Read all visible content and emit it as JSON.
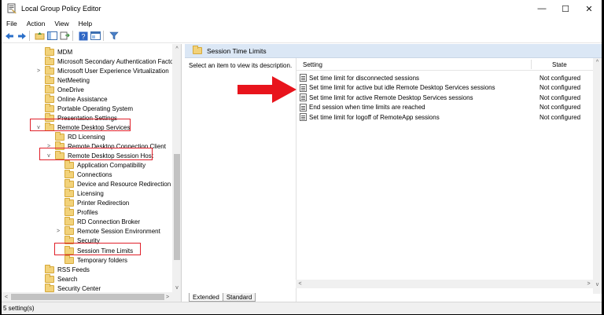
{
  "window": {
    "title": "Local Group Policy Editor",
    "minimize_glyph": "—",
    "maximize_glyph": "☐",
    "close_glyph": "✕"
  },
  "menu": [
    "File",
    "Action",
    "View",
    "Help"
  ],
  "toolbar": {
    "icons": [
      "back-arrow-icon",
      "forward-arrow-icon",
      "folder-up-icon",
      "show-hide-tree-icon",
      "export-list-icon",
      "help-icon",
      "properties-icon",
      "filter-icon"
    ]
  },
  "tree": {
    "items": [
      {
        "label": "MDM",
        "expander": ""
      },
      {
        "label": "Microsoft Secondary Authentication Facto",
        "expander": ""
      },
      {
        "label": "Microsoft User Experience Virtualization",
        "expander": ">"
      },
      {
        "label": "NetMeeting",
        "expander": ""
      },
      {
        "label": "OneDrive",
        "expander": ""
      },
      {
        "label": "Online Assistance",
        "expander": ""
      },
      {
        "label": "Portable Operating System",
        "expander": ""
      },
      {
        "label": "Presentation Settings",
        "expander": ""
      },
      {
        "label": "Remote Desktop Services",
        "expander": "v"
      },
      {
        "label": "RD Licensing",
        "expander": ""
      },
      {
        "label": "Remote Desktop Connection Client",
        "expander": ">"
      },
      {
        "label": "Remote Desktop Session Host",
        "expander": "v"
      },
      {
        "label": "Application Compatibility",
        "expander": ""
      },
      {
        "label": "Connections",
        "expander": ""
      },
      {
        "label": "Device and Resource Redirection",
        "expander": ""
      },
      {
        "label": "Licensing",
        "expander": ""
      },
      {
        "label": "Printer Redirection",
        "expander": ""
      },
      {
        "label": "Profiles",
        "expander": ""
      },
      {
        "label": "RD Connection Broker",
        "expander": ""
      },
      {
        "label": "Remote Session Environment",
        "expander": ">"
      },
      {
        "label": "Security",
        "expander": ""
      },
      {
        "label": "Session Time Limits",
        "expander": ""
      },
      {
        "label": "Temporary folders",
        "expander": ""
      },
      {
        "label": "RSS Feeds",
        "expander": ""
      },
      {
        "label": "Search",
        "expander": ""
      },
      {
        "label": "Security Center",
        "expander": ""
      }
    ],
    "scroll_up": "^",
    "scroll_down": "v",
    "scroll_left": "<",
    "scroll_right": ">"
  },
  "details": {
    "header_title": "Session Time Limits",
    "description": "Select an item to view its description.",
    "columns": {
      "setting": "Setting",
      "state": "State"
    },
    "rows": [
      {
        "name": "Set time limit for disconnected sessions",
        "state": "Not configured"
      },
      {
        "name": "Set time limit for active but idle Remote Desktop Services sessions",
        "state": "Not configured"
      },
      {
        "name": "Set time limit for active Remote Desktop Services sessions",
        "state": "Not configured"
      },
      {
        "name": "End session when time limits are reached",
        "state": "Not configured"
      },
      {
        "name": "Set time limit for logoff of RemoteApp sessions",
        "state": "Not configured"
      }
    ],
    "tabs": [
      "Extended",
      "Standard"
    ],
    "scroll_up": "^",
    "scroll_down": "v",
    "scroll_left": "<",
    "scroll_right": ">"
  },
  "status": {
    "text": "5 setting(s)"
  },
  "colors": {
    "highlight_box": "#e0202a",
    "arrow": "#e8141c",
    "header_band": "#dbe7f5",
    "folder": "#f2d27a"
  }
}
